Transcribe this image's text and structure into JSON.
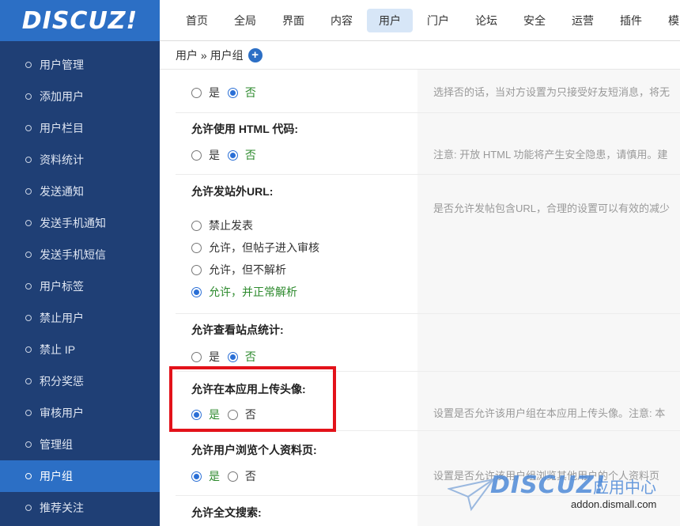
{
  "logo": "DISCUZ!",
  "sidebar": {
    "items": [
      {
        "label": "用户管理"
      },
      {
        "label": "添加用户"
      },
      {
        "label": "用户栏目"
      },
      {
        "label": "资料统计"
      },
      {
        "label": "发送通知"
      },
      {
        "label": "发送手机通知"
      },
      {
        "label": "发送手机短信"
      },
      {
        "label": "用户标签"
      },
      {
        "label": "禁止用户"
      },
      {
        "label": "禁止 IP"
      },
      {
        "label": "积分奖惩"
      },
      {
        "label": "审核用户"
      },
      {
        "label": "管理组"
      },
      {
        "label": "用户组",
        "active": true
      },
      {
        "label": "推荐关注"
      }
    ]
  },
  "topnav": {
    "tabs": [
      "首页",
      "全局",
      "界面",
      "内容",
      "用户",
      "门户",
      "论坛",
      "安全",
      "运营",
      "插件",
      "模"
    ],
    "active": "用户"
  },
  "breadcrumb": {
    "path": "用户 » 用户组",
    "add_icon": "plus-circle-icon"
  },
  "settings": [
    {
      "label": "",
      "options": [
        "是",
        "否"
      ],
      "selected": "否",
      "desc": "选择否的话，当对方设置为只接受好友短消息，将无"
    },
    {
      "label": "允许使用 HTML 代码:",
      "options": [
        "是",
        "否"
      ],
      "selected": "否",
      "desc": "注意: 开放 HTML 功能将产生安全隐患，请慎用。建"
    },
    {
      "label": "允许发站外URL:",
      "options": [
        "禁止发表",
        "允许，但帖子进入审核",
        "允许，但不解析",
        "允许，并正常解析"
      ],
      "selected": "允许，并正常解析",
      "desc": "是否允许发帖包含URL，合理的设置可以有效的减少"
    },
    {
      "label": "允许查看站点统计:",
      "options": [
        "是",
        "否"
      ],
      "selected": "否",
      "desc": ""
    },
    {
      "label": "允许在本应用上传头像:",
      "options": [
        "是",
        "否"
      ],
      "selected": "是",
      "desc": "设置是否允许该用户组在本应用上传头像。注意: 本"
    },
    {
      "label": "允许用户浏览个人资料页:",
      "options": [
        "是",
        "否"
      ],
      "selected": "是",
      "desc": "设置是否允许该用户组浏览其他用户的个人资料页"
    },
    {
      "label": "允许全文搜索:",
      "options": [],
      "selected": "",
      "desc": ""
    }
  ],
  "watermark": {
    "brand": "DISCUZ!",
    "cn": "应用中心",
    "url": "addon.dismall.com"
  },
  "colors": {
    "sidebar_bg": "#1f3f75",
    "accent": "#2c6fc5",
    "highlight": "#e3121a",
    "checked_text": "#2d8a2d"
  }
}
